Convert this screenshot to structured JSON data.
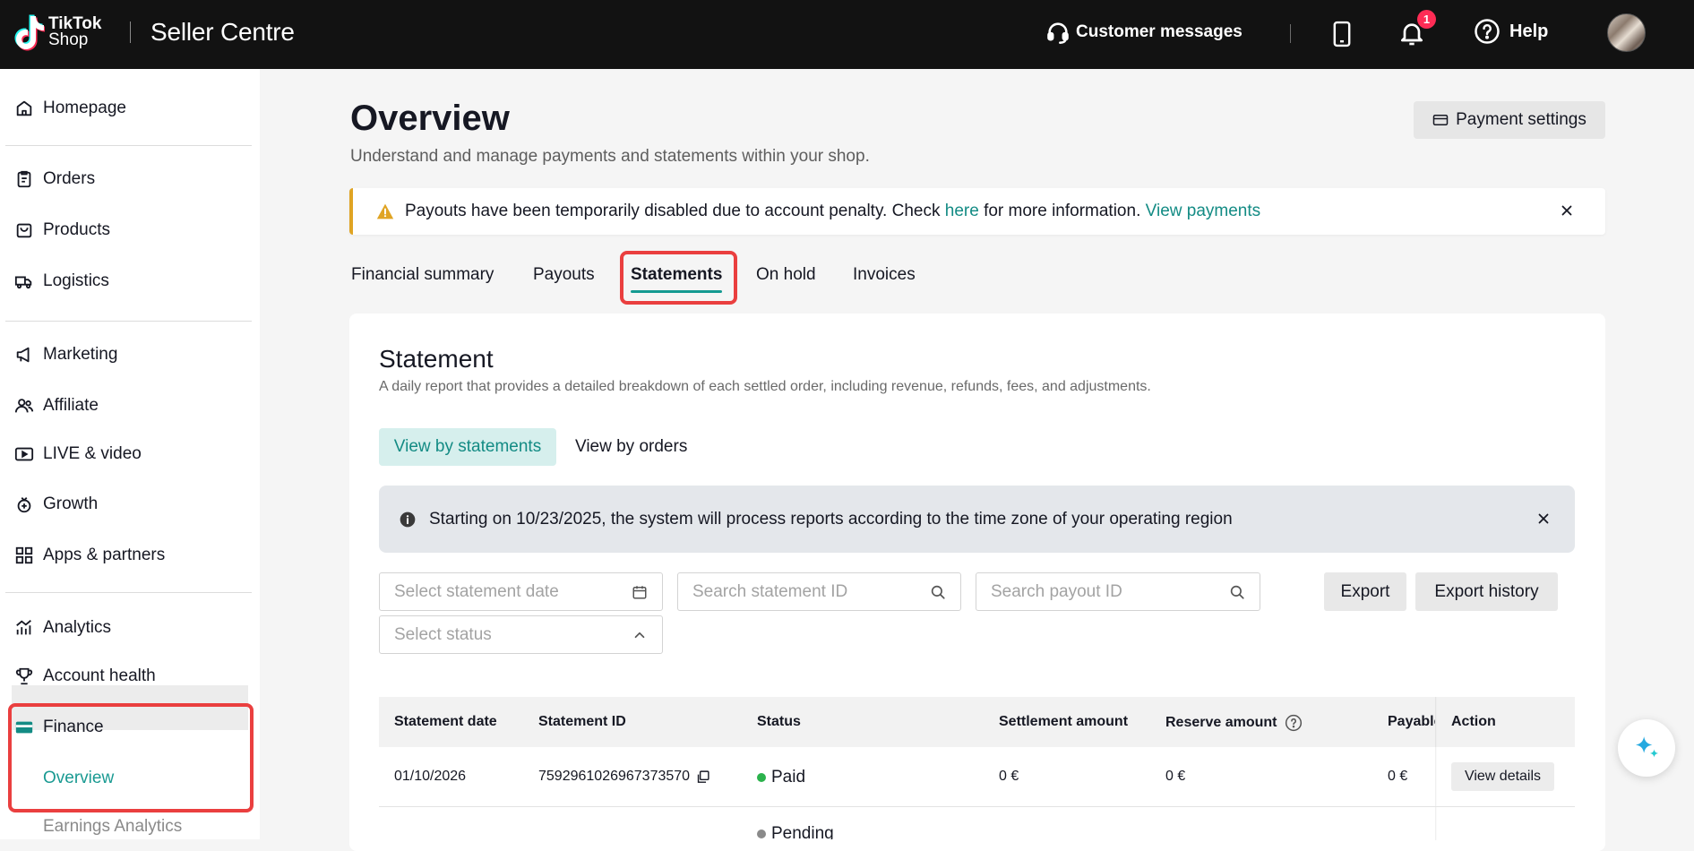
{
  "header": {
    "logo_line1": "TikTok",
    "logo_line2": "Shop",
    "brand": "Seller Centre",
    "customer_messages": "Customer messages",
    "notification_count": "1",
    "help": "Help"
  },
  "sidebar": {
    "items": [
      {
        "label": "Homepage",
        "icon": "home-icon"
      },
      {
        "label": "Orders",
        "icon": "clipboard-icon"
      },
      {
        "label": "Products",
        "icon": "bag-icon"
      },
      {
        "label": "Logistics",
        "icon": "truck-icon"
      },
      {
        "label": "Marketing",
        "icon": "megaphone-icon"
      },
      {
        "label": "Affiliate",
        "icon": "users-icon"
      },
      {
        "label": "LIVE & video",
        "icon": "video-icon"
      },
      {
        "label": "Growth",
        "icon": "growth-icon"
      },
      {
        "label": "Apps & partners",
        "icon": "apps-icon"
      },
      {
        "label": "Analytics",
        "icon": "analytics-icon"
      },
      {
        "label": "Account health",
        "icon": "trophy-icon"
      },
      {
        "label": "Finance",
        "icon": "card-icon"
      }
    ],
    "sub_overview": "Overview",
    "sub_earnings": "Earnings Analytics"
  },
  "main": {
    "title": "Overview",
    "subtitle": "Understand and manage payments and statements within your shop.",
    "payment_settings": "Payment settings",
    "alert": {
      "text_before": "Payouts have been temporarily disabled due to account penalty. Check",
      "link_here": "here",
      "text_after": "for more information.",
      "link_view": "View payments"
    },
    "tabs": [
      "Financial summary",
      "Payouts",
      "Statements",
      "On hold",
      "Invoices"
    ],
    "active_tab": "Statements"
  },
  "statement": {
    "title": "Statement",
    "subtitle": "A daily report that provides a detailed breakdown of each settled order, including revenue, refunds, fees, and adjustments.",
    "view_by_statements": "View by statements",
    "view_by_orders": "View by orders",
    "info": "Starting on 10/23/2025, the system will process reports according to the time zone of your operating region",
    "filters": {
      "date_placeholder": "Select statement date",
      "statement_id_placeholder": "Search statement ID",
      "payout_id_placeholder": "Search payout ID",
      "status_placeholder": "Select status"
    },
    "export": "Export",
    "export_history": "Export history",
    "columns": [
      "Statement date",
      "Statement ID",
      "Status",
      "Settlement amount",
      "Reserve amount",
      "Payable",
      "Action"
    ],
    "rows": [
      {
        "date": "01/10/2026",
        "id": "7592961026967373570",
        "status": "Paid",
        "settlement": "0 €",
        "reserve": "0 €",
        "payable": "0 €",
        "action": "View details"
      },
      {
        "status": "Pending"
      }
    ]
  },
  "colors": {
    "accent": "#138b84",
    "paid": "#2bb24c",
    "pending": "#8a8a8a",
    "highlight": "#ea3f3f"
  }
}
